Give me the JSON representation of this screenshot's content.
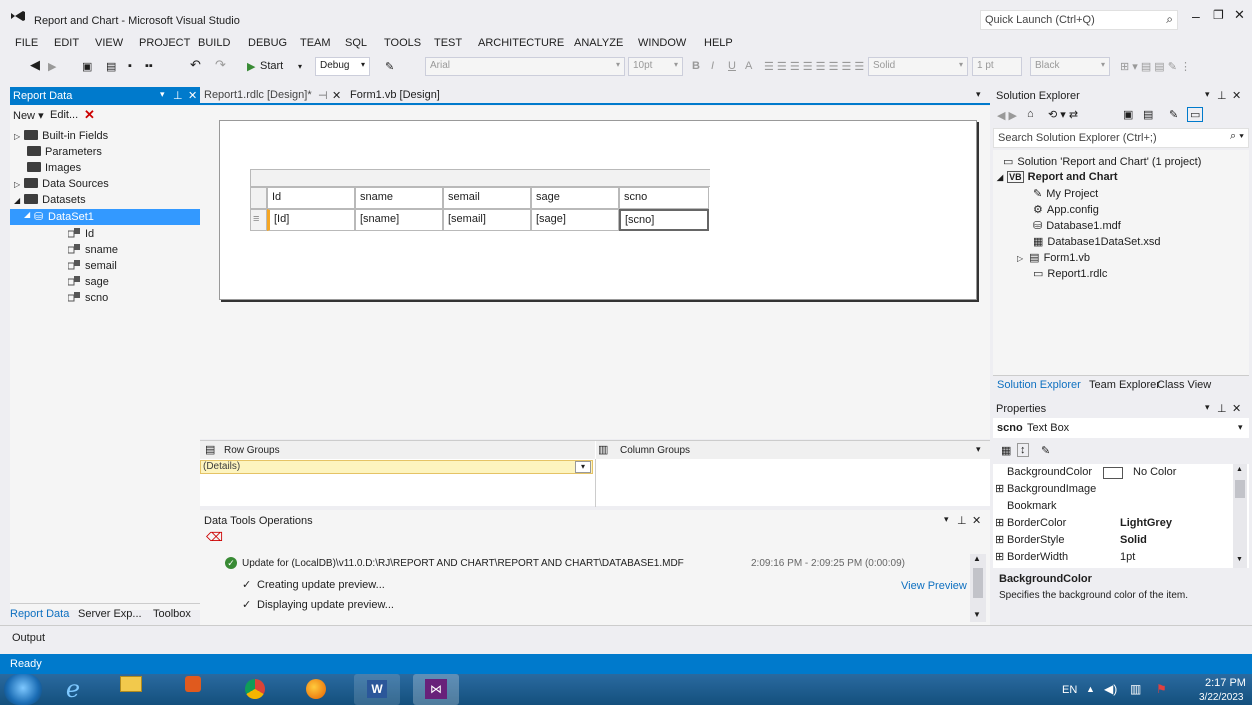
{
  "window": {
    "title": "Report and Chart - Microsoft Visual Studio",
    "quick_launch": "Quick Launch (Ctrl+Q)"
  },
  "menu": [
    "FILE",
    "EDIT",
    "VIEW",
    "PROJECT",
    "BUILD",
    "DEBUG",
    "TEAM",
    "SQL",
    "TOOLS",
    "TEST",
    "ARCHITECTURE",
    "ANALYZE",
    "WINDOW",
    "HELP"
  ],
  "toolbar": {
    "start": "Start",
    "config": "Debug",
    "font": "Arial",
    "size": "10pt",
    "border_style": "Solid",
    "border_width": "1 pt",
    "color": "Black"
  },
  "report_data": {
    "title": "Report Data",
    "new": "New",
    "edit": "Edit...",
    "items": [
      {
        "label": "Built-in Fields"
      },
      {
        "label": "Parameters"
      },
      {
        "label": "Images"
      },
      {
        "label": "Data Sources"
      },
      {
        "label": "Datasets"
      },
      {
        "label": "DataSet1"
      },
      {
        "label": "Id"
      },
      {
        "label": "sname"
      },
      {
        "label": "semail"
      },
      {
        "label": "sage"
      },
      {
        "label": "scno"
      }
    ],
    "bottom_tabs": [
      "Report Data",
      "Server Exp...",
      "Toolbox"
    ]
  },
  "doc_tabs": [
    {
      "label": "Report1.rdlc [Design]*"
    },
    {
      "label": "Form1.vb [Design]"
    }
  ],
  "table": {
    "headers": [
      "Id",
      "sname",
      "semail",
      "sage",
      "scno"
    ],
    "row": [
      "[Id]",
      "[sname]",
      "[semail]",
      "[sage]",
      "[scno]"
    ]
  },
  "groups": {
    "row_title": "Row Groups",
    "col_title": "Column Groups",
    "details": "(Details)"
  },
  "data_tools": {
    "title": "Data Tools Operations",
    "update": "Update for (LocalDB)\\v11.0.D:\\RJ\\REPORT AND CHART\\REPORT AND CHART\\DATABASE1.MDF",
    "time": "2:09:16 PM - 2:09:25 PM (0:00:09)",
    "step1": "Creating update preview...",
    "step2": "Displaying update preview...",
    "view_preview": "View Preview"
  },
  "solution_explorer": {
    "title": "Solution Explorer",
    "search": "Search Solution Explorer (Ctrl+;)",
    "solution": "Solution 'Report and Chart' (1 project)",
    "project": "Report and Chart",
    "items": [
      "My Project",
      "App.config",
      "Database1.mdf",
      "Database1DataSet.xsd",
      "Form1.vb",
      "Report1.rdlc"
    ],
    "tabs": [
      "Solution Explorer",
      "Team Explorer",
      "Class View"
    ]
  },
  "properties": {
    "title": "Properties",
    "object": "scno",
    "type": "Text Box",
    "rows": [
      {
        "name": "BackgroundColor",
        "value": "No Color"
      },
      {
        "name": "BackgroundImage",
        "value": ""
      },
      {
        "name": "Bookmark",
        "value": ""
      },
      {
        "name": "BorderColor",
        "value": "LightGrey"
      },
      {
        "name": "BorderStyle",
        "value": "Solid"
      },
      {
        "name": "BorderWidth",
        "value": "1pt"
      }
    ],
    "desc_title": "BackgroundColor",
    "desc": "Specifies the background color of the item."
  },
  "output": {
    "label": "Output"
  },
  "status": {
    "text": "Ready"
  },
  "taskbar": {
    "lang": "EN",
    "time": "2:17 PM",
    "date": "3/22/2023"
  },
  "colors": {
    "accent": "#007acc",
    "selection": "#3399ff",
    "taskbar": "#1c5a8c"
  }
}
